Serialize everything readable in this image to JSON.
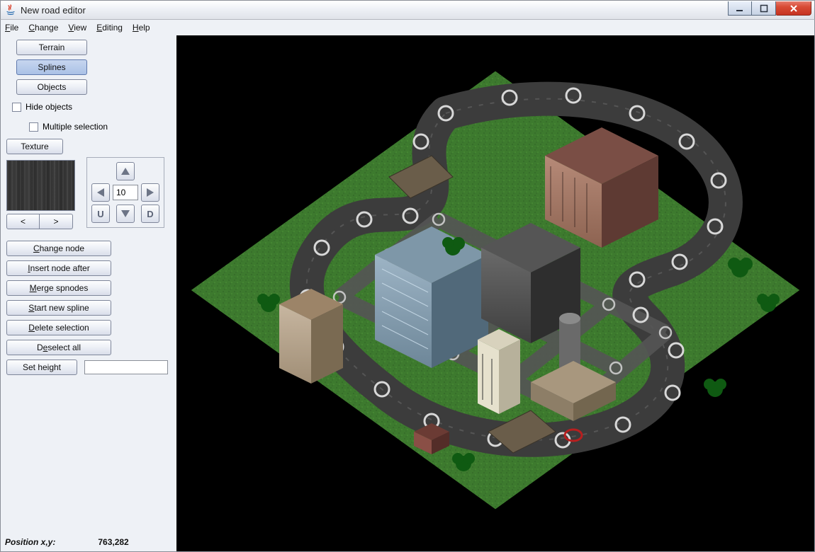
{
  "window": {
    "title": "New road editor"
  },
  "menus": [
    "File",
    "Change",
    "View",
    "Editing",
    "Help"
  ],
  "sidebar": {
    "tabs": {
      "terrain": "Terrain",
      "splines": "Splines",
      "objects": "Objects"
    },
    "hide_objects": "Hide objects",
    "multiple_selection": "Multiple selection",
    "texture_btn": "Texture",
    "prev": "<",
    "next": ">",
    "nav_value": "10",
    "nav_u": "U",
    "nav_d": "D",
    "actions": {
      "change_node": "Change node",
      "insert_node_after": "Insert node after",
      "merge_spnodes": "Merge spnodes",
      "start_new_spline": "Start new spline",
      "delete_selection": "Delete selection",
      "deselect_all": "Deselect all"
    },
    "set_height": "Set height",
    "set_height_value": ""
  },
  "status": {
    "label": "Position x,y:",
    "value": "763,282"
  }
}
